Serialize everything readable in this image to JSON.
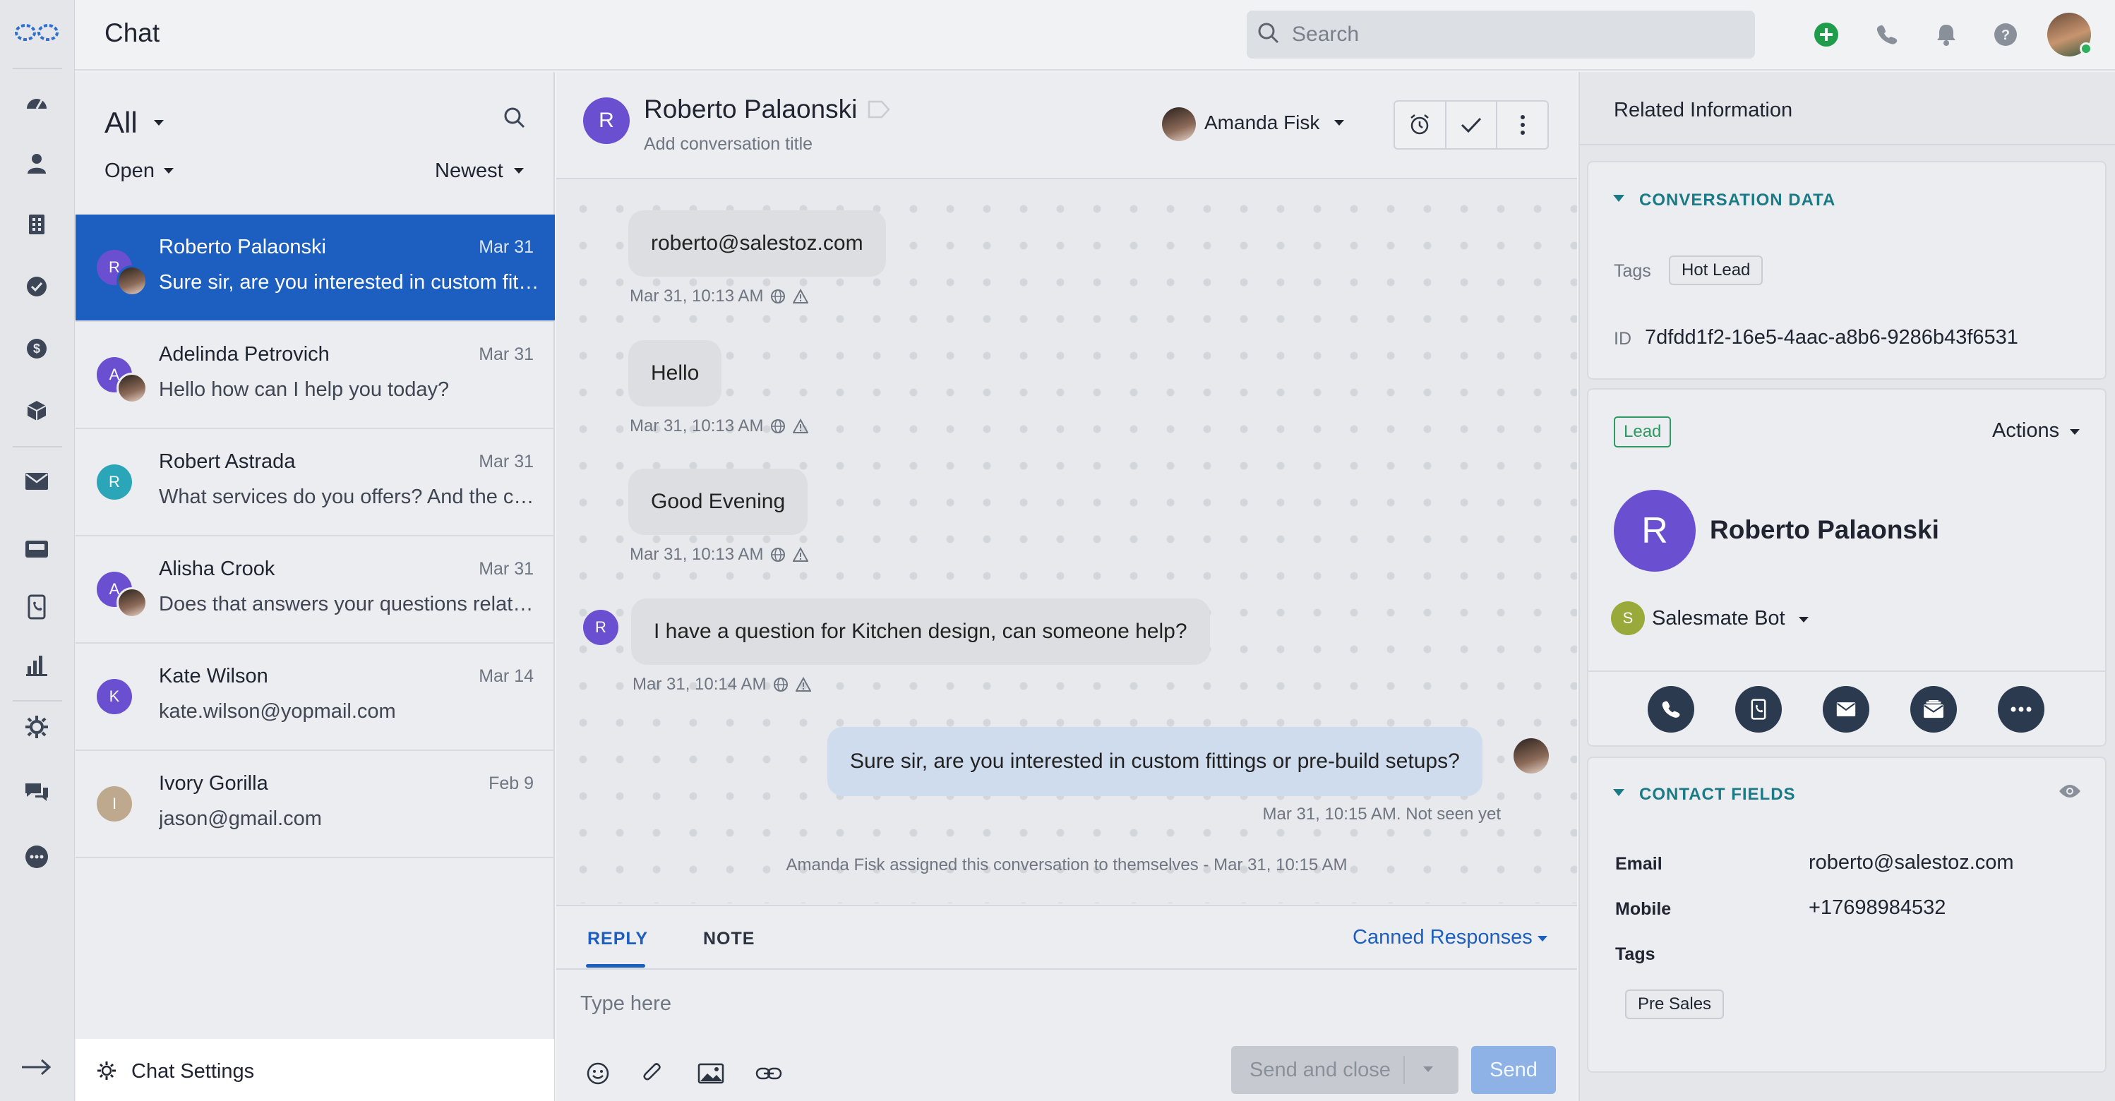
{
  "app": {
    "title": "Chat"
  },
  "search": {
    "placeholder": "Search"
  },
  "rail": {
    "items": [
      "logo-icon",
      "dashboard-icon",
      "contacts-icon",
      "companies-icon",
      "tasks-icon",
      "deals-icon",
      "products-icon",
      "email-icon",
      "inbox-icon",
      "phone-log-icon",
      "reports-icon",
      "automation-icon",
      "chat-icon",
      "more-icon",
      "expand-icon"
    ]
  },
  "topbar": {
    "icons": [
      "add-icon",
      "phone-icon",
      "bell-icon",
      "help-icon"
    ]
  },
  "list": {
    "filter": "All",
    "status": "Open",
    "sort": "Newest",
    "conversations": [
      {
        "name": "Roberto Palaonski",
        "date": "Mar 31",
        "preview": "Sure sir, are you interested in custom fittings or pre-build setups?",
        "initial": "R",
        "color": "#6a4fd0",
        "active": true,
        "agent": true
      },
      {
        "name": "Adelinda Petrovich",
        "date": "Mar 31",
        "preview": "Hello how can I help you today?",
        "initial": "A",
        "color": "#6a4fd0",
        "active": false,
        "agent": true
      },
      {
        "name": "Robert Astrada",
        "date": "Mar 31",
        "preview": "What services do you offers? And the cost?",
        "initial": "R",
        "color": "#2aa6b8",
        "active": false,
        "agent": false
      },
      {
        "name": "Alisha Crook",
        "date": "Mar 31",
        "preview": "Does that answers your questions related to this?",
        "initial": "A",
        "color": "#6a4fd0",
        "active": false,
        "agent": true
      },
      {
        "name": "Kate Wilson",
        "date": "Mar 14",
        "preview": "kate.wilson@yopmail.com",
        "initial": "K",
        "color": "#6a4fd0",
        "active": false,
        "agent": false
      },
      {
        "name": "Ivory Gorilla",
        "date": "Feb 9",
        "preview": "jason@gmail.com",
        "initial": "I",
        "color": "#bfa98e",
        "active": false,
        "agent": false
      }
    ],
    "settings_label": "Chat Settings"
  },
  "conversation": {
    "contact_initial": "R",
    "contact_name": "Roberto Palaonski",
    "subtitle": "Add conversation title",
    "assignee": "Amanda Fisk",
    "messages": [
      {
        "text": "roberto@salestoz.com",
        "meta": "Mar 31, 10:13 AM"
      },
      {
        "text": "Hello",
        "meta": "Mar 31, 10:13 AM"
      },
      {
        "text": "Good Evening",
        "meta": "Mar 31, 10:13 AM"
      },
      {
        "text": "I have a question for Kitchen design, can someone help?",
        "meta": "Mar 31, 10:14 AM",
        "initial": "R"
      },
      {
        "text": "Sure sir, are you interested in custom fittings or pre-build setups?",
        "meta": "Mar 31, 10:15 AM. Not seen yet"
      }
    ],
    "system_note": "Amanda Fisk assigned this conversation to themselves - Mar 31, 10:15 AM"
  },
  "composer": {
    "tab_reply": "REPLY",
    "tab_note": "NOTE",
    "canned": "Canned Responses",
    "placeholder": "Type here",
    "send_close": "Send and close",
    "send": "Send"
  },
  "related": {
    "title": "Related Information",
    "conversation_data": {
      "section": "CONVERSATION DATA",
      "tags_label": "Tags",
      "tag": "Hot Lead",
      "id_label": "ID",
      "id_value": "7dfdd1f2-16e5-4aac-a8b6-9286b43f6531"
    },
    "contact": {
      "badge": "Lead",
      "actions": "Actions",
      "initial": "R",
      "name": "Roberto Palaonski",
      "owner_initial": "S",
      "owner": "Salesmate Bot"
    },
    "contact_fields": {
      "section": "CONTACT FIELDS",
      "email_label": "Email",
      "email": "roberto@salestoz.com",
      "mobile_label": "Mobile",
      "mobile": "+17698984532",
      "tags_label": "Tags",
      "tag": "Pre Sales"
    }
  },
  "colors": {
    "accent": "#1d5fc0",
    "teal": "#1a7a86",
    "lead_green": "#2c9a62",
    "avatar_purple": "#6a4fd0"
  }
}
